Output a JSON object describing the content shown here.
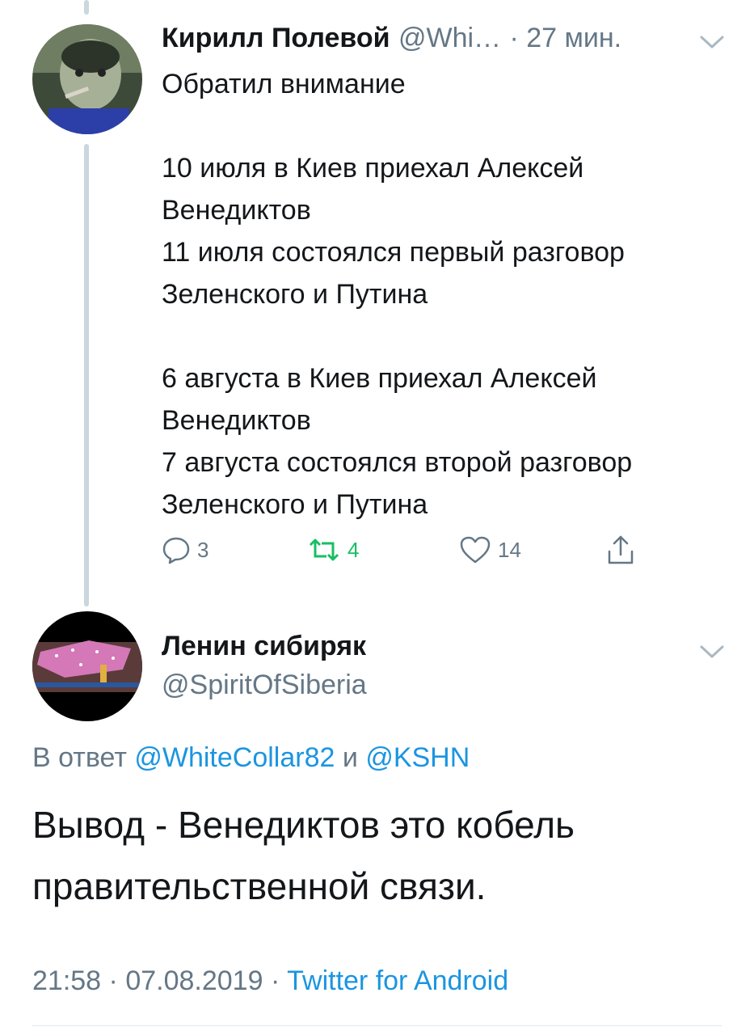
{
  "parent_tweet": {
    "author_name": "Кирилл Полевой",
    "handle": "@Whi…",
    "time": "· 27 мин.",
    "text": "Обратил внимание\n\n10 июля в Киев приехал Алексей Венедиктов\n11 июля состоялся первый разговор Зеленского и Путина\n\n6 августа в Киев приехал Алексей Венедиктов\n7 августа состоялся второй разговор Зеленского и Путина",
    "replies": "3",
    "retweets": "4",
    "likes": "14",
    "icons": [
      "reply-icon",
      "retweet-icon",
      "like-icon",
      "share-icon",
      "chevron-down-icon"
    ]
  },
  "main_tweet": {
    "author_name": "Ленин сибиряк",
    "handle": "@SpiritOfSiberia",
    "reply_prefix": "В ответ",
    "reply_to_1": "@WhiteCollar82",
    "reply_and": "и",
    "reply_to_2": "@KSHN",
    "text": "Вывод - Венедиктов это кобель правительственной связи.",
    "time": "21:58",
    "date": "07.08.2019",
    "separator": "·",
    "source": "Twitter for Android"
  },
  "colors": {
    "link": "#1b95e0",
    "muted": "#657786",
    "retweet": "#17bf63",
    "thread_line": "#ccd6dd"
  }
}
